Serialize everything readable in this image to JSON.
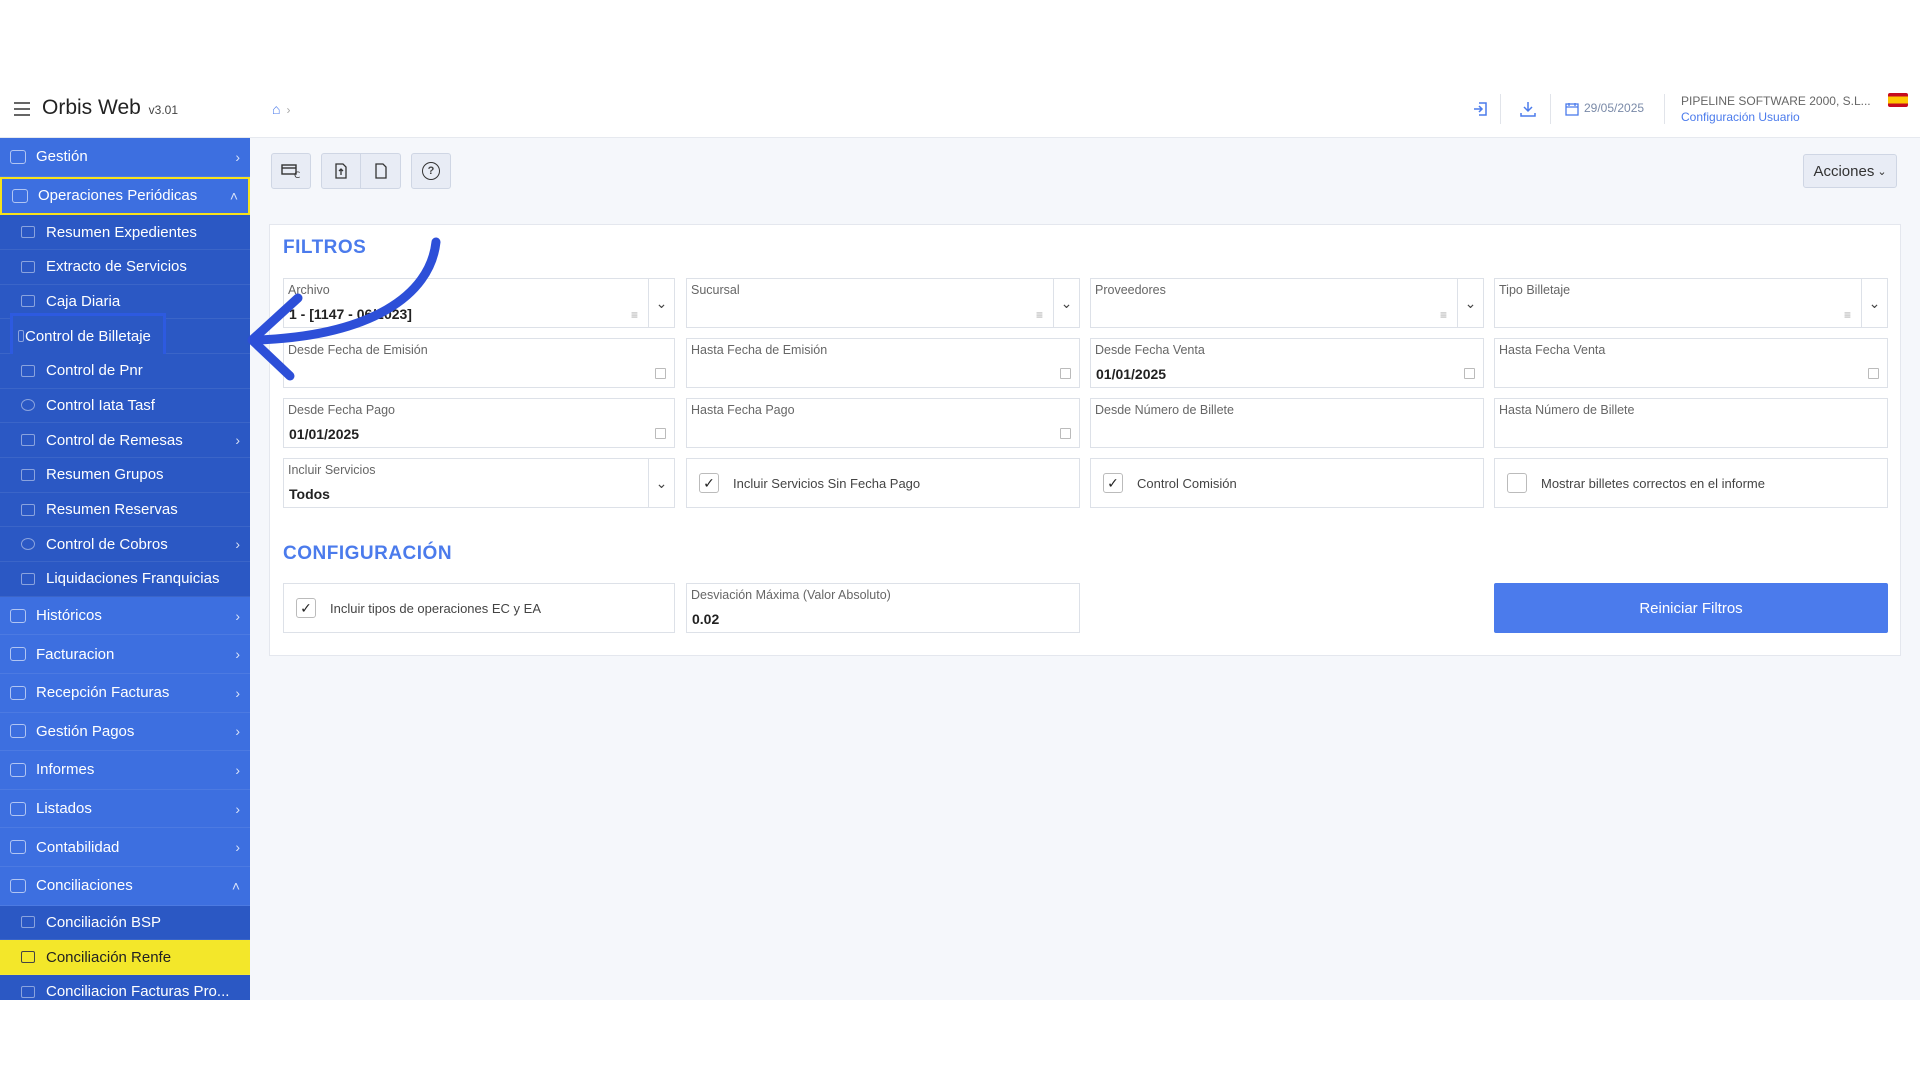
{
  "header": {
    "app_name": "Orbis Web",
    "version": "v3.01",
    "breadcrumb_sep": "›",
    "date": "29/05/2025",
    "company": "PIPELINE SOFTWARE 2000, S.L...",
    "config_link": "Configuración Usuario"
  },
  "sidebar": {
    "items": [
      {
        "label": "Gestión",
        "arrow": "›"
      },
      {
        "label": "Operaciones Periódicas",
        "arrow": "˄"
      },
      {
        "label": "Históricos",
        "arrow": "›"
      },
      {
        "label": "Facturacion",
        "arrow": "›"
      },
      {
        "label": "Recepción Facturas",
        "arrow": "›"
      },
      {
        "label": "Gestión Pagos",
        "arrow": "›"
      },
      {
        "label": "Informes",
        "arrow": "›"
      },
      {
        "label": "Listados",
        "arrow": "›"
      },
      {
        "label": "Contabilidad",
        "arrow": "›"
      },
      {
        "label": "Conciliaciones",
        "arrow": "˄"
      }
    ],
    "periodicas_sub": [
      {
        "label": "Resumen Expedientes"
      },
      {
        "label": "Extracto de Servicios"
      },
      {
        "label": "Caja Diaria"
      },
      {
        "label": "Control de Billetaje"
      },
      {
        "label": "Control de Pnr"
      },
      {
        "label": "Control Iata Tasf"
      },
      {
        "label": "Control de Remesas",
        "arrow": "›"
      },
      {
        "label": "Resumen Grupos"
      },
      {
        "label": "Resumen Reservas"
      },
      {
        "label": "Control de Cobros",
        "arrow": "›"
      },
      {
        "label": "Liquidaciones Franquicias"
      }
    ],
    "conciliaciones_sub": [
      {
        "label": "Conciliación BSP"
      },
      {
        "label": "Conciliación Renfe"
      },
      {
        "label": "Conciliacion Facturas Pro..."
      }
    ]
  },
  "toolbar": {
    "acciones_label": "Acciones",
    "help_icon": "?"
  },
  "filtros": {
    "title": "FILTROS",
    "archivo": {
      "label": "Archivo",
      "value": "1 - [1147 - 06/2023]"
    },
    "sucursal": {
      "label": "Sucursal",
      "value": ""
    },
    "proveedores": {
      "label": "Proveedores",
      "value": ""
    },
    "tipo_billetaje": {
      "label": "Tipo Billetaje",
      "value": ""
    },
    "desde_fecha_emision": {
      "label": "Desde Fecha de Emisión",
      "value": ""
    },
    "hasta_fecha_emision": {
      "label": "Hasta Fecha de Emisión",
      "value": ""
    },
    "desde_fecha_venta": {
      "label": "Desde Fecha Venta",
      "value": "01/01/2025"
    },
    "hasta_fecha_venta": {
      "label": "Hasta Fecha Venta",
      "value": ""
    },
    "desde_fecha_pago": {
      "label": "Desde Fecha Pago",
      "value": "01/01/2025"
    },
    "hasta_fecha_pago": {
      "label": "Hasta Fecha Pago",
      "value": ""
    },
    "desde_num_billete": {
      "label": "Desde Número de Billete",
      "value": ""
    },
    "hasta_num_billete": {
      "label": "Hasta Número de Billete",
      "value": ""
    },
    "incluir_servicios": {
      "label": "Incluir Servicios",
      "value": "Todos"
    },
    "chk_sin_fecha_pago": {
      "label": "Incluir Servicios Sin Fecha Pago",
      "checked": true
    },
    "chk_control_comision": {
      "label": "Control Comisión",
      "checked": true
    },
    "chk_mostrar_correctos": {
      "label": "Mostrar billetes correctos en el informe",
      "checked": false
    }
  },
  "configuracion": {
    "title": "CONFIGURACIÓN",
    "chk_incluir_ec_ea": {
      "label": "Incluir tipos de operaciones EC y EA",
      "checked": true
    },
    "desviacion": {
      "label": "Desviación Máxima (Valor Absoluto)",
      "value": "0.02"
    },
    "reset_label": "Reiniciar Filtros"
  },
  "colors": {
    "brand": "#4b7bec",
    "sidebar": "#3d6fe0",
    "highlight": "#f3e72a"
  }
}
